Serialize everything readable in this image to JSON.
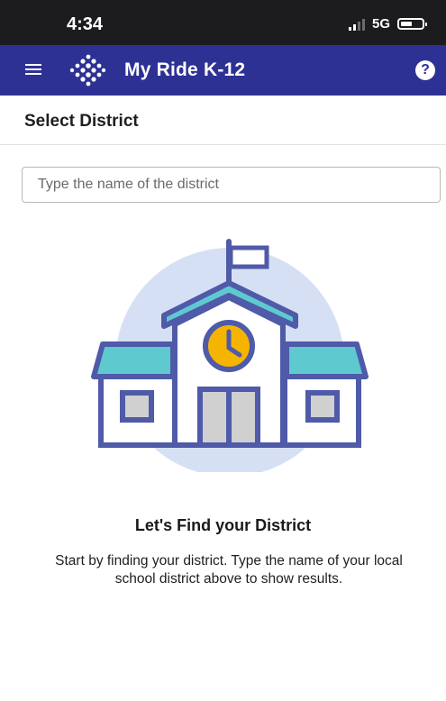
{
  "status_bar": {
    "time": "4:34",
    "network": "5G"
  },
  "app_bar": {
    "title": "My Ride K-12",
    "help_label": "?"
  },
  "page": {
    "title": "Select District"
  },
  "search": {
    "placeholder": "Type the name of the district",
    "value": ""
  },
  "empty_state": {
    "title": "Let's Find your District",
    "description": "Start by finding your district. Type the name of your local school district above to show results."
  },
  "colors": {
    "app_bar": "#2e3194",
    "building_stroke": "#4f5aa8",
    "roof_fill": "#5fc9d0",
    "circle_bg": "#d6e0f5",
    "clock_fill": "#f5b400",
    "window_fill": "#d0d0d0"
  },
  "icons": {
    "menu": "hamburger-menu-icon",
    "logo": "dot-diamond-logo-icon",
    "help": "question-circle-icon",
    "illustration": "school-building-icon"
  }
}
